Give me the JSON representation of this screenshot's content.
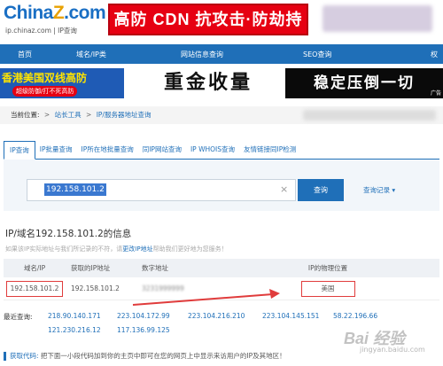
{
  "header": {
    "logo_main": "China",
    "logo_z": "Z",
    "logo_domain": ".com",
    "logo_sub": "ip.chinaz.com | IP查询",
    "top_ad": "高防 CDN 抗攻击·防劫持"
  },
  "nav": {
    "items": [
      "首页",
      "域名/IP类",
      "网站信息查询",
      "SEO查询",
      "权"
    ]
  },
  "ads": {
    "left_line1": "香港美国双线高防",
    "left_line2": "超级防御/打不死高防",
    "mid": "重金收量",
    "right": "稳定压倒一切",
    "right_tag": "广告"
  },
  "breadcrumb": {
    "prefix": "当前位置:",
    "item1": "站长工具",
    "sep": ">",
    "item2": "IP/服务器地址查询"
  },
  "tabs": [
    {
      "label": "IP查询",
      "active": true
    },
    {
      "label": "IP批量查询"
    },
    {
      "label": "IP所在地批量查询"
    },
    {
      "label": "同IP网站查询"
    },
    {
      "label": "IP WHOIS查询"
    },
    {
      "label": "友情链接同IP检测"
    }
  ],
  "search": {
    "value": "192.158.101.2",
    "clear": "×",
    "button": "查询",
    "history": "查询记录 ▾"
  },
  "result": {
    "title": "IP/域名192.158.101.2的信息",
    "note_before": "如果该IP实际地址与我们所记录的不符，请",
    "note_link": "更改IP地址",
    "note_after": "帮助我们更好地为您服务！"
  },
  "table": {
    "headers": [
      "域名/IP",
      "获取的IP地址",
      "数字地址",
      "IP的物理位置"
    ],
    "row": [
      "192.158.101.2",
      "192.158.101.2",
      "3231999999",
      "美国"
    ]
  },
  "recent": {
    "label": "最近查询:",
    "ips": [
      "218.90.140.171",
      "223.104.172.99",
      "223.104.216.210",
      "223.104.145.151",
      "58.22.196.66",
      "121.230.216.12",
      "117.136.99.125"
    ]
  },
  "getcode": {
    "label": "获取代码:",
    "text": "把下面一小段代码加到你的主页中即可在您的网页上中显示来访用户的IP及其地区！"
  },
  "watermark": {
    "main": "Bai 经验",
    "sub": "jingyan.baidu.com"
  },
  "colors": {
    "brand_blue": "#1f6fb8",
    "highlight_red": "#e03c3c",
    "ad_red": "#e60012"
  }
}
